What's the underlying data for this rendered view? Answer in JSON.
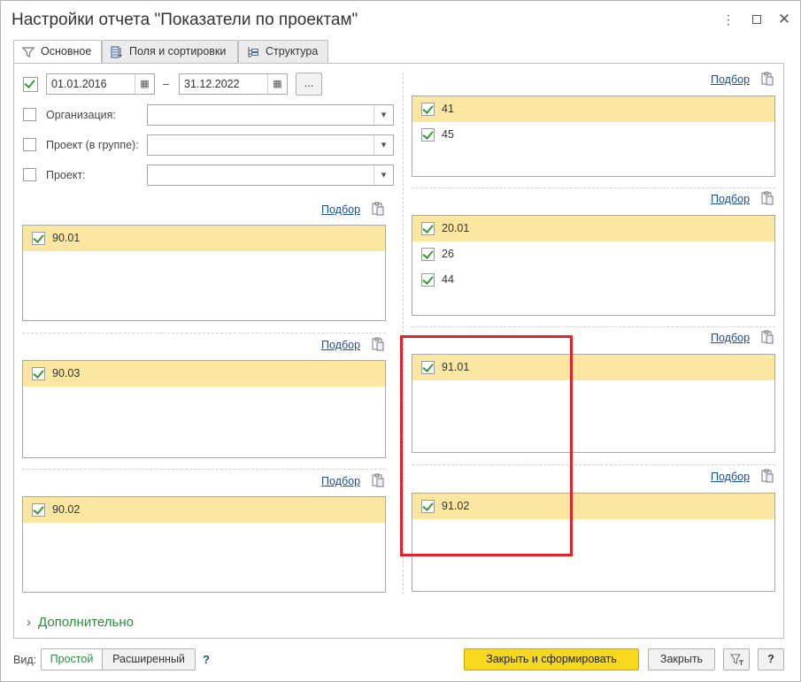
{
  "window": {
    "title": "Настройки отчета \"Показатели по проектам\"",
    "more_icon": "more-vertical-icon",
    "maximize_icon": "maximize-icon",
    "close_icon": "close-icon"
  },
  "tabs": [
    {
      "label": "Основное",
      "icon": "filter-icon"
    },
    {
      "label": "Поля и сортировки",
      "icon": "fields-icon"
    },
    {
      "label": "Структура",
      "icon": "structure-icon"
    }
  ],
  "period": {
    "enabled": true,
    "from": "01.01.2016",
    "to": "31.12.2022",
    "dash": "–",
    "more_label": "..."
  },
  "filters": [
    {
      "label": "Организация:",
      "value": "",
      "checked": false
    },
    {
      "label": "Проект (в группе):",
      "value": "",
      "checked": false
    },
    {
      "label": "Проект:",
      "value": "",
      "checked": false
    }
  ],
  "pick_label": "Подбор",
  "left_lists": [
    {
      "rows": [
        {
          "text": "90.01",
          "checked": true
        }
      ]
    },
    {
      "rows": [
        {
          "text": "90.03",
          "checked": true
        }
      ]
    },
    {
      "rows": [
        {
          "text": "90.02",
          "checked": true
        }
      ]
    }
  ],
  "right_lists": [
    {
      "rows": [
        {
          "text": "41",
          "checked": true
        },
        {
          "text": "45",
          "checked": true
        }
      ]
    },
    {
      "rows": [
        {
          "text": "20.01",
          "checked": true
        },
        {
          "text": "26",
          "checked": true
        },
        {
          "text": "44",
          "checked": true
        }
      ]
    },
    {
      "rows": [
        {
          "text": "91.01",
          "checked": true
        }
      ]
    },
    {
      "rows": [
        {
          "text": "91.02",
          "checked": true
        }
      ]
    }
  ],
  "additional_label": "Дополнительно",
  "footer": {
    "view_label": "Вид:",
    "simple_label": "Простой",
    "extended_label": "Расширенный",
    "help_q": "?",
    "generate_label": "Закрыть и сформировать",
    "close_label": "Закрыть",
    "help_label": "?"
  },
  "colors": {
    "selected_row": "#fbe6a2",
    "accent_green": "#3a9a3a",
    "primary_button": "#f8d81e",
    "highlight_red": "#e0242a",
    "link": "#1a4f9c"
  }
}
